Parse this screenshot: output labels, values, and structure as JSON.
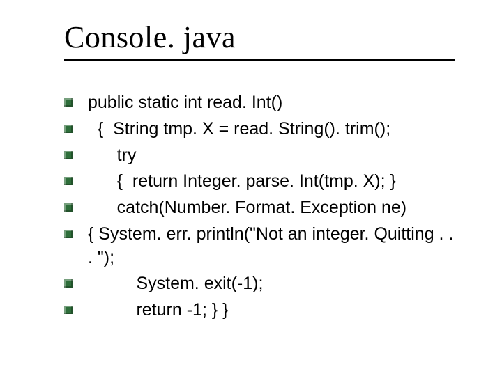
{
  "title": "Console. java",
  "lines": [
    "public static int read. Int()",
    "  {  String tmp. X = read. String(). trim();",
    "      try",
    "      {  return Integer. parse. Int(tmp. X); }",
    "      catch(Number. Format. Exception ne)",
    "      {  System. err. println(\"Not an integer. Quitting . . . \");",
    "          System. exit(-1);",
    "          return -1; } }"
  ]
}
